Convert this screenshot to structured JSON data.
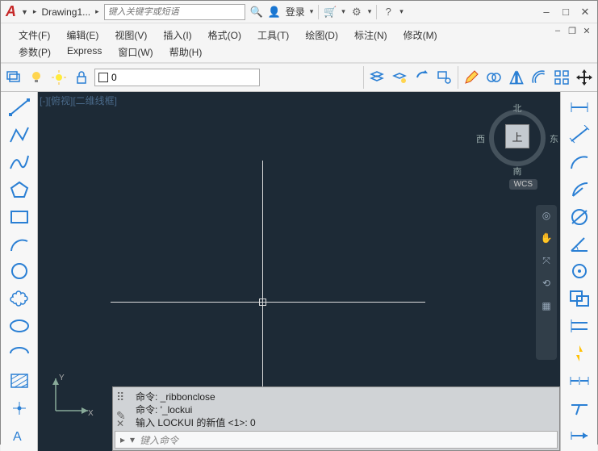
{
  "title": {
    "doc_name": "Drawing1..."
  },
  "search": {
    "placeholder": "键入关键字或短语"
  },
  "account": {
    "login": "登录"
  },
  "menus": {
    "row1": [
      "文件(F)",
      "编辑(E)",
      "视图(V)",
      "插入(I)",
      "格式(O)",
      "工具(T)",
      "绘图(D)",
      "标注(N)",
      "修改(M)"
    ],
    "row2": [
      "参数(P)",
      "Express",
      "窗口(W)",
      "帮助(H)"
    ]
  },
  "layer": {
    "current": "0"
  },
  "viewport": {
    "label": "[-][俯视][二维线框]"
  },
  "viewcube": {
    "north": "北",
    "south": "南",
    "east": "东",
    "west": "西",
    "top": "上",
    "wcs": "WCS"
  },
  "command": {
    "hist1": "命令: _ribbonclose",
    "hist2": "命令: '_lockui",
    "hist3": "输入 LOCKUI 的新值 <1>: 0",
    "prompt_icon": "▸",
    "placeholder": "键入命令"
  }
}
